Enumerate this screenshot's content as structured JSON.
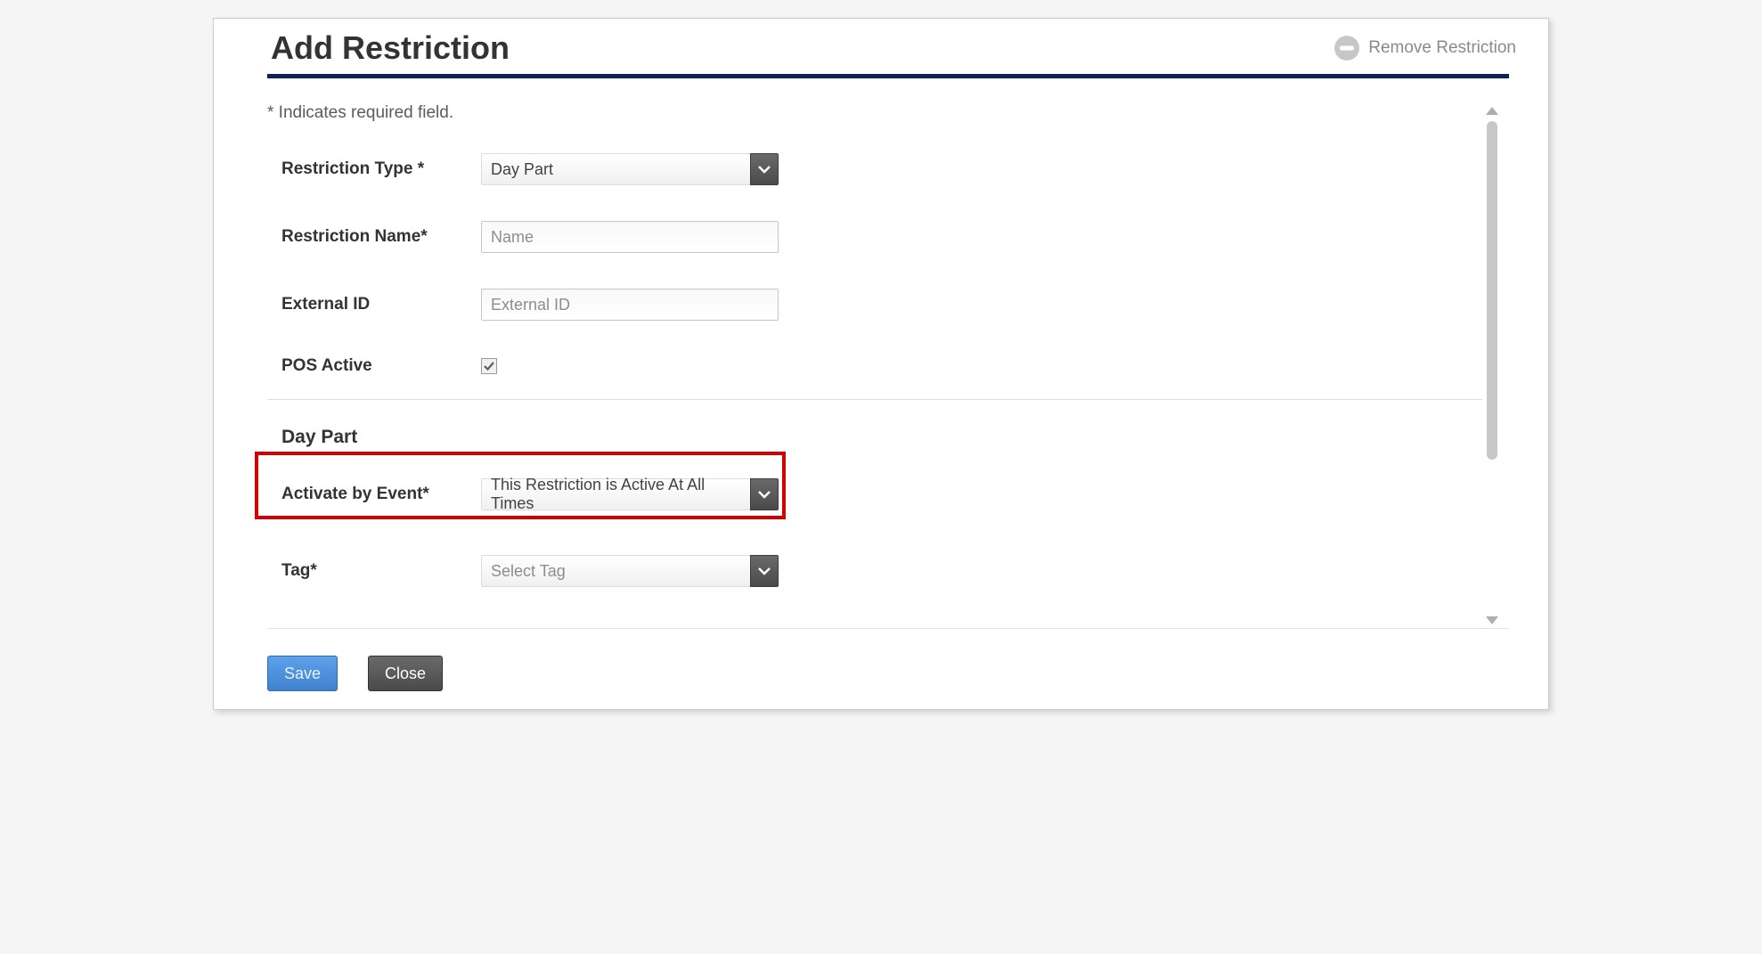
{
  "header": {
    "title": "Add Restriction",
    "remove_label": "Remove Restriction"
  },
  "form": {
    "required_note": "* Indicates required field.",
    "restriction_type": {
      "label": "Restriction Type *",
      "value": "Day Part"
    },
    "restriction_name": {
      "label": "Restriction Name*",
      "placeholder": "Name",
      "value": ""
    },
    "external_id": {
      "label": "External ID",
      "placeholder": "External ID",
      "value": ""
    },
    "pos_active": {
      "label": "POS Active",
      "checked": true
    },
    "section_title": "Day Part",
    "activate_by_event": {
      "label": "Activate by Event*",
      "value": "This Restriction is Active At All Times"
    },
    "tag": {
      "label": "Tag*",
      "placeholder": "Select Tag",
      "value": ""
    }
  },
  "footer": {
    "save_label": "Save",
    "close_label": "Close"
  }
}
